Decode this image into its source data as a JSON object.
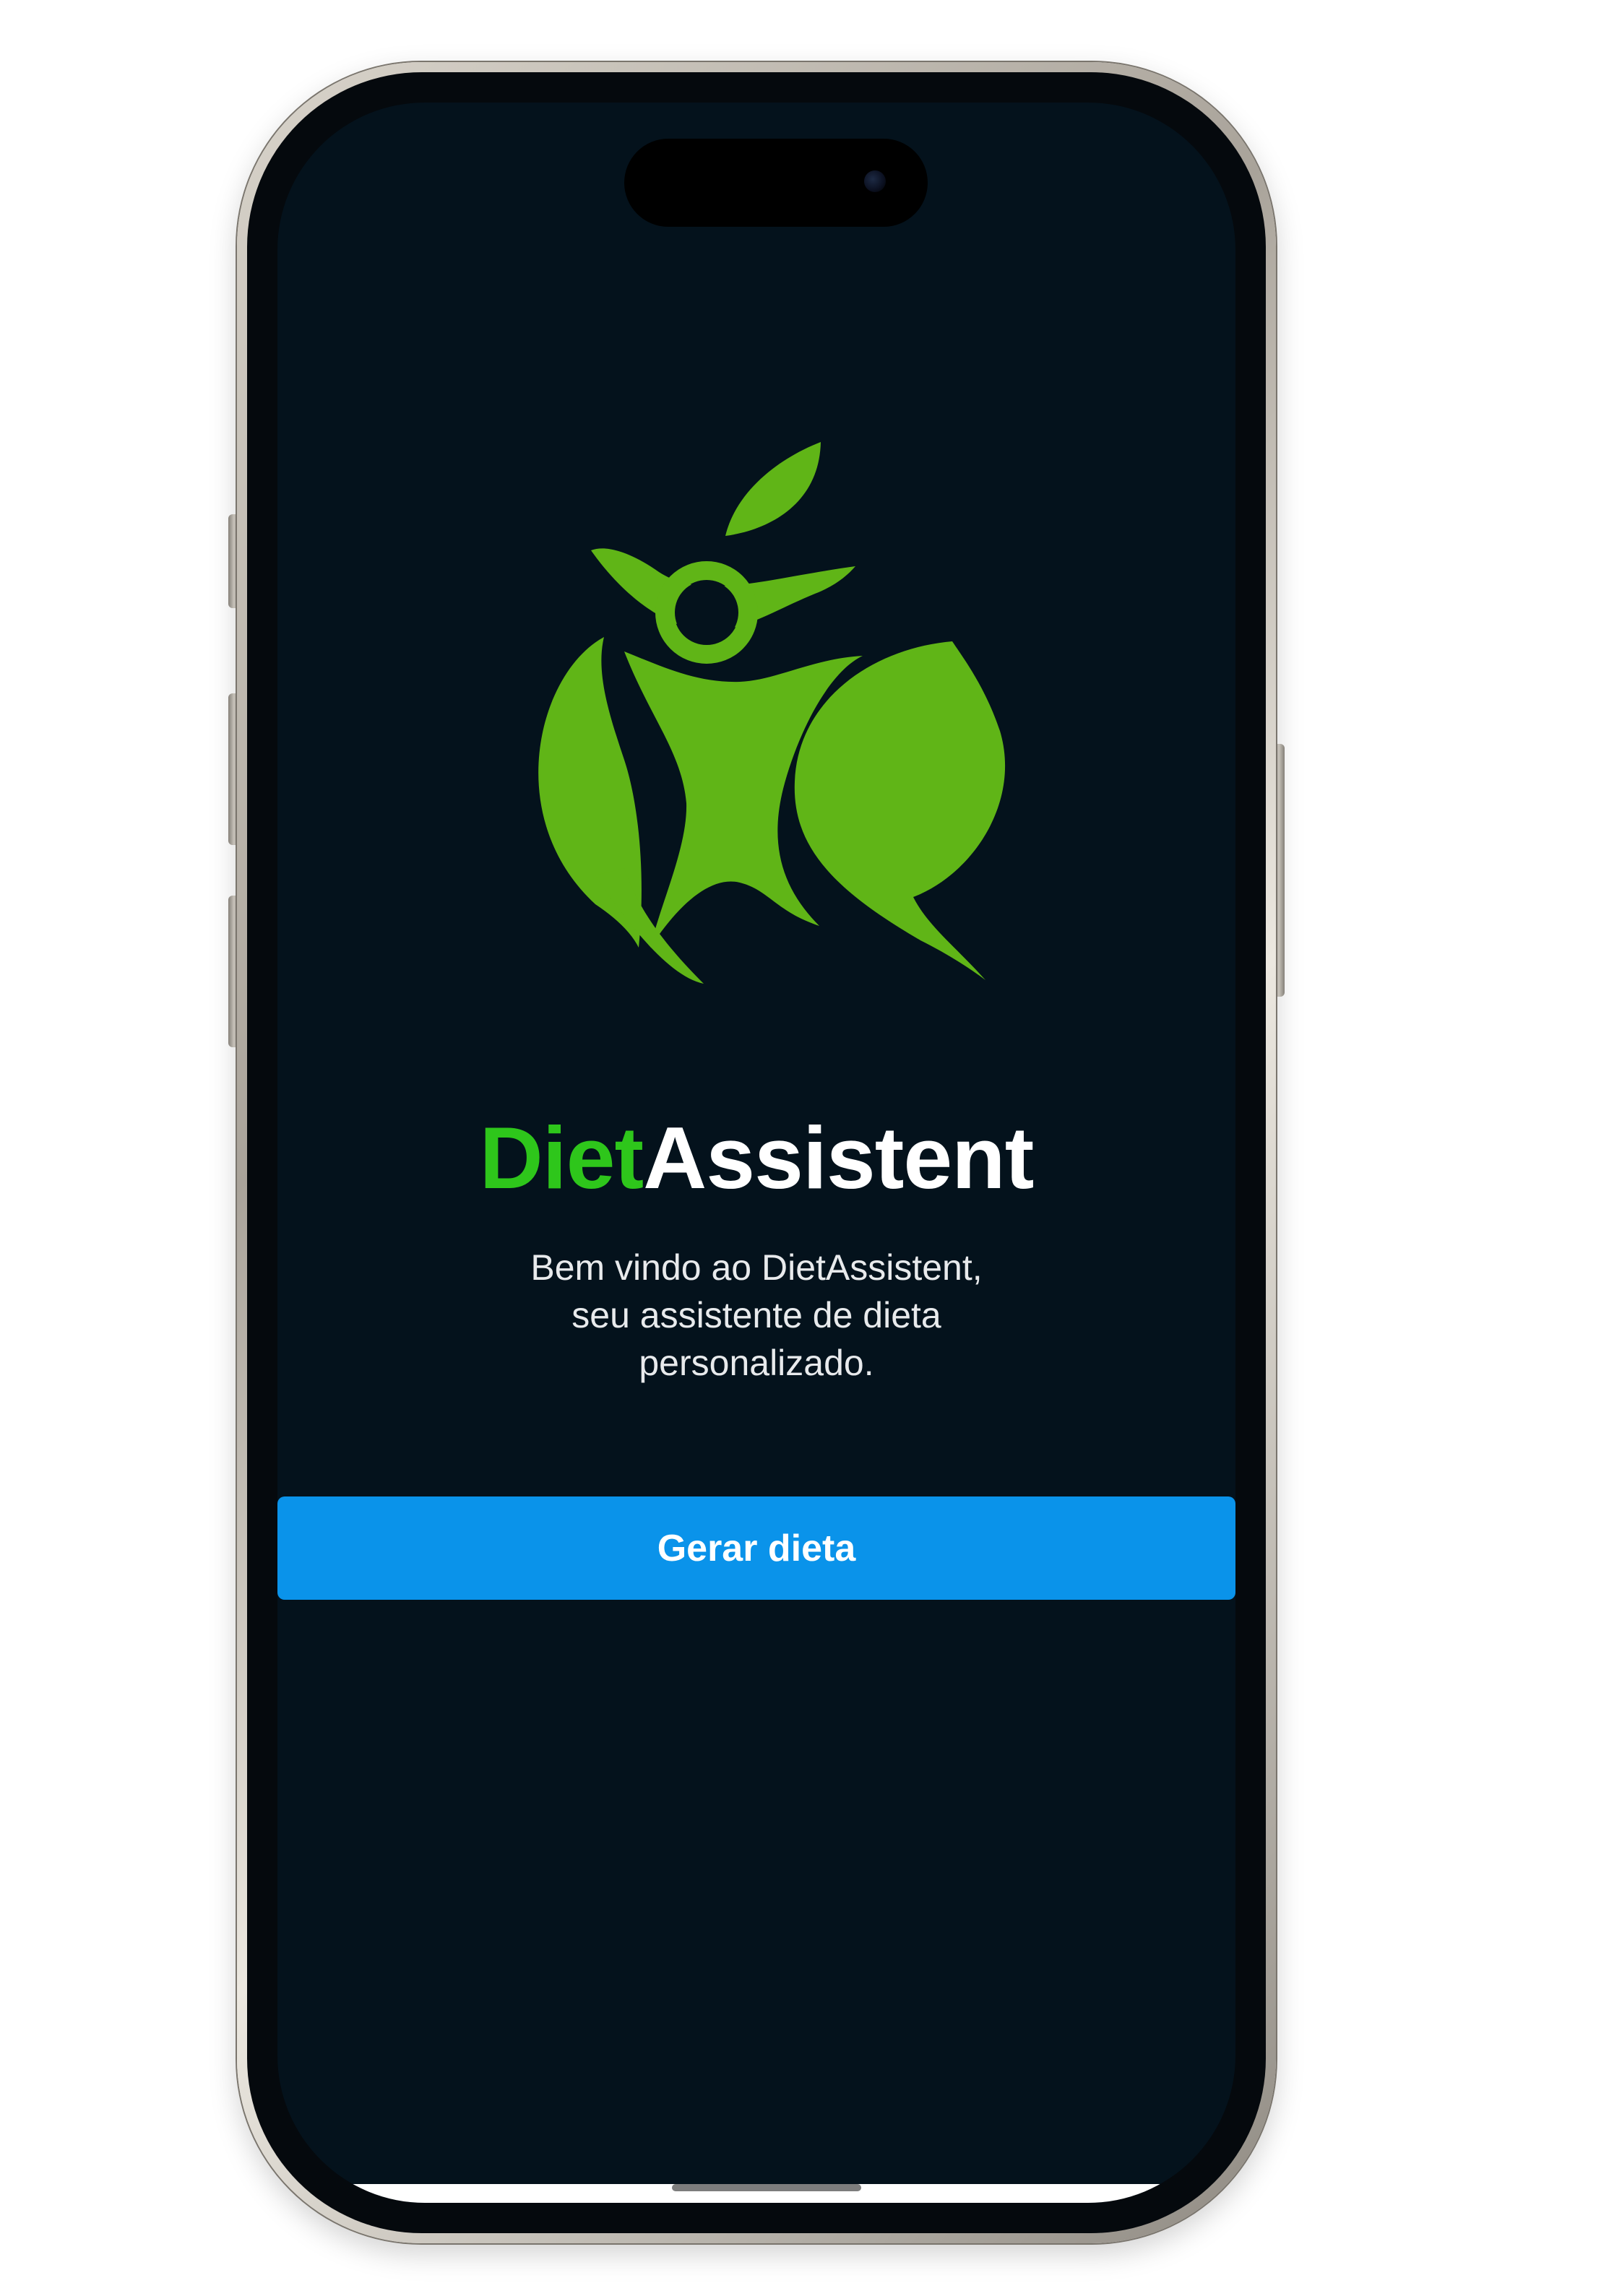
{
  "app": {
    "title_part1": "Diet",
    "title_part2": "Assistent",
    "welcome_lines": [
      "Bem vindo ao DietAssistent,",
      "seu assistente de dieta",
      "personalizado."
    ]
  },
  "actions": {
    "generate_label": "Gerar dieta"
  },
  "icons": {
    "logo": "leaf-person-logo-icon",
    "camera": "front-camera-icon"
  },
  "colors": {
    "brand_green": "#2ec61b",
    "logo_green": "#60b517",
    "screen_background": "#04121c",
    "button_blue": "#0a93ea"
  }
}
